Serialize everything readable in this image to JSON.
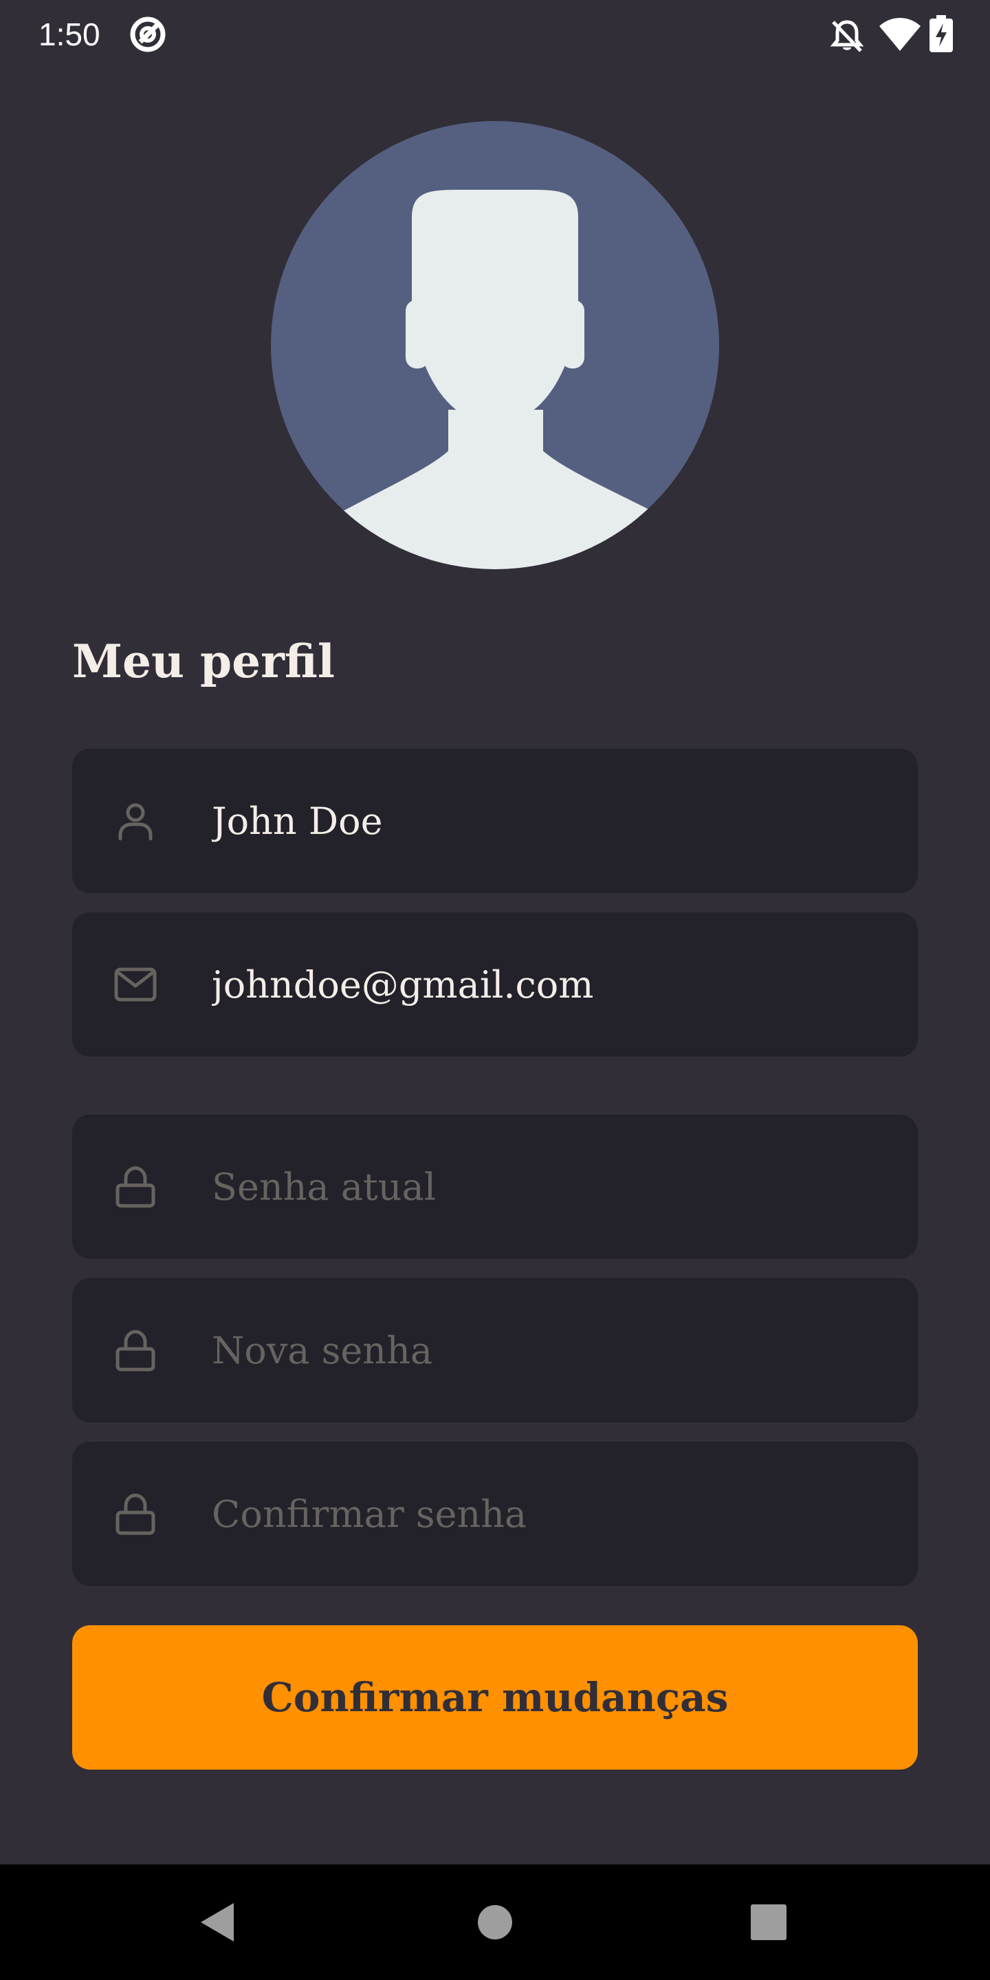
{
  "status_bar": {
    "time": "1:50",
    "icons": [
      "app-notification-icon",
      "notifications-off-icon",
      "wifi-icon",
      "battery-charging-icon"
    ]
  },
  "profile": {
    "avatar_icon": "default-user-avatar",
    "title": "Meu perfil"
  },
  "form": {
    "name": {
      "value": "John Doe",
      "icon": "user-icon"
    },
    "email": {
      "value": "johndoe@gmail.com",
      "icon": "mail-icon"
    },
    "current_password": {
      "placeholder": "Senha atual",
      "icon": "lock-icon"
    },
    "new_password": {
      "placeholder": "Nova senha",
      "icon": "lock-icon"
    },
    "confirm_password": {
      "placeholder": "Confirmar senha",
      "icon": "lock-icon"
    },
    "submit_label": "Confirmar mudanças"
  },
  "nav_bar": {
    "icons": [
      "back-icon",
      "home-icon",
      "recents-icon"
    ]
  },
  "colors": {
    "background": "#312e38",
    "input_background": "#232129",
    "accent": "#ff9000",
    "text": "#f4ede8",
    "placeholder": "#666360",
    "avatar_background": "#556080",
    "avatar_silhouette": "#e7eced"
  }
}
